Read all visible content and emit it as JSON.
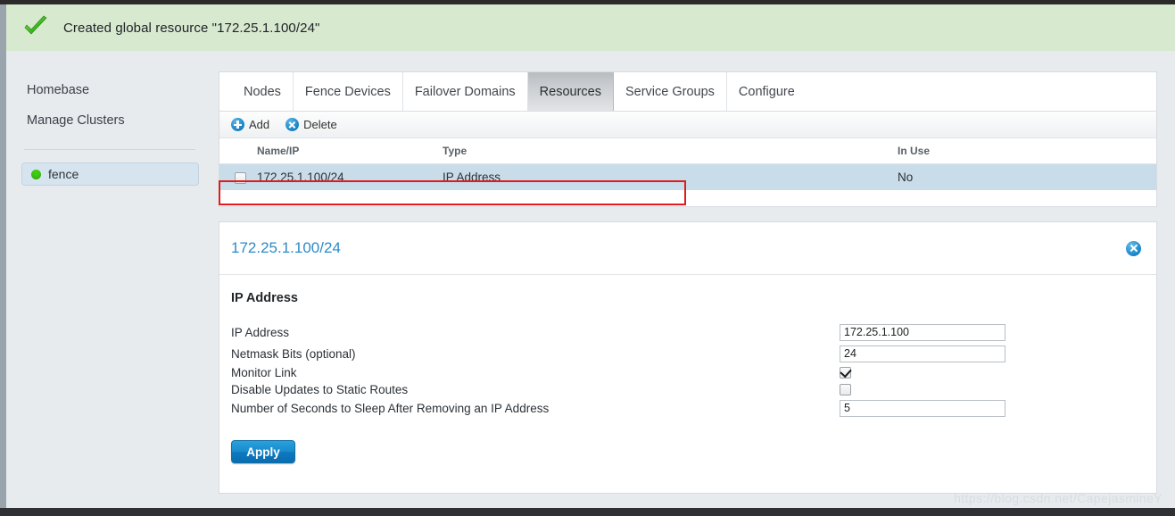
{
  "banner": {
    "icon": "green-check-icon",
    "message": "Created global resource \"172.25.1.100/24\""
  },
  "sidebar": {
    "links": [
      {
        "label": "Homebase"
      },
      {
        "label": "Manage Clusters"
      }
    ],
    "clusters": [
      {
        "label": "fence",
        "status": "online",
        "status_color": "#3fcc12"
      }
    ]
  },
  "tabs": [
    {
      "label": "Nodes",
      "active": false
    },
    {
      "label": "Fence Devices",
      "active": false
    },
    {
      "label": "Failover Domains",
      "active": false
    },
    {
      "label": "Resources",
      "active": true
    },
    {
      "label": "Service Groups",
      "active": false
    },
    {
      "label": "Configure",
      "active": false
    }
  ],
  "toolbar": {
    "add_label": "Add",
    "delete_label": "Delete"
  },
  "table": {
    "columns": [
      "Name/IP",
      "Type",
      "In Use"
    ],
    "rows": [
      {
        "name": "172.25.1.100/24",
        "type": "IP Address",
        "in_use": "No",
        "selected": true,
        "checked": false
      }
    ]
  },
  "detail": {
    "title": "172.25.1.100/24",
    "close_icon": "close-circle-icon",
    "section_title": "IP Address",
    "fields": [
      {
        "label": "IP Address",
        "type": "text",
        "value": "172.25.1.100"
      },
      {
        "label": "Netmask Bits (optional)",
        "type": "text",
        "value": "24"
      },
      {
        "label": "Monitor Link",
        "type": "checkbox",
        "checked": true
      },
      {
        "label": "Disable Updates to Static Routes",
        "type": "checkbox",
        "checked": false
      },
      {
        "label": "Number of Seconds to Sleep After Removing an IP Address",
        "type": "text",
        "value": "5"
      }
    ],
    "apply_label": "Apply"
  },
  "watermark": "https://blog.csdn.net/CapejasmineY",
  "colors": {
    "banner_bg": "#d7e9cf",
    "accent_blue": "#2e8bc6",
    "selected_row": "#c9dce9",
    "annotation_red": "#e01b1b"
  }
}
